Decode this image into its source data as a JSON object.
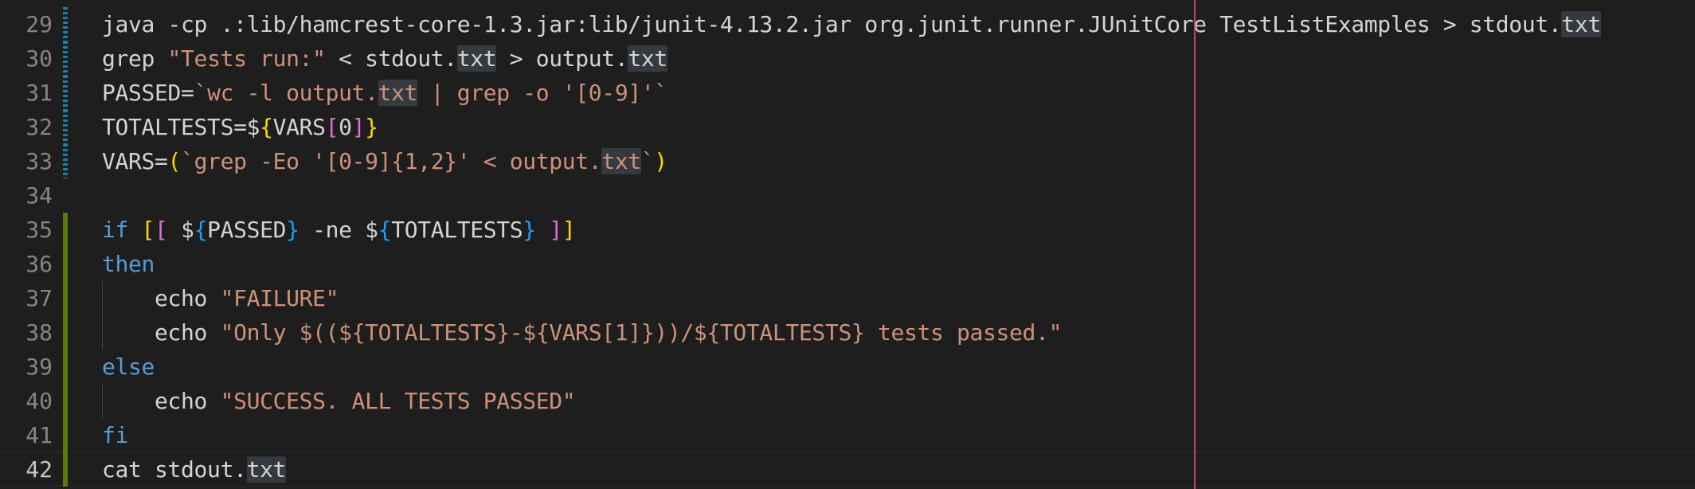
{
  "editor": {
    "lines": [
      {
        "number": "29",
        "gutter": "modified",
        "current": false,
        "tokens": [
          {
            "t": "java -cp .:lib/hamcrest-core-1.3.jar:lib/junit-4.13.2.jar org.junit.runner.JUnitCore TestListExamples > stdout.",
            "c": ""
          },
          {
            "t": "txt",
            "c": "hl"
          }
        ]
      },
      {
        "number": "30",
        "gutter": "modified",
        "current": false,
        "tokens": [
          {
            "t": "grep ",
            "c": ""
          },
          {
            "t": "\"Tests run:\"",
            "c": "str"
          },
          {
            "t": " < stdout.",
            "c": ""
          },
          {
            "t": "txt",
            "c": "hl"
          },
          {
            "t": " > output.",
            "c": ""
          },
          {
            "t": "txt",
            "c": "hl"
          }
        ]
      },
      {
        "number": "31",
        "gutter": "modified",
        "current": false,
        "tokens": [
          {
            "t": "PASSED=",
            "c": ""
          },
          {
            "t": "`wc -l output.",
            "c": "str"
          },
          {
            "t": "txt",
            "c": "str hl"
          },
          {
            "t": " | grep -o '[0-9]'`",
            "c": "str"
          }
        ]
      },
      {
        "number": "32",
        "gutter": "modified",
        "current": false,
        "tokens": [
          {
            "t": "TOTALTESTS=$",
            "c": ""
          },
          {
            "t": "{",
            "c": "b1"
          },
          {
            "t": "VARS",
            "c": ""
          },
          {
            "t": "[",
            "c": "b2"
          },
          {
            "t": "0",
            "c": ""
          },
          {
            "t": "]",
            "c": "b2"
          },
          {
            "t": "}",
            "c": "b1"
          }
        ]
      },
      {
        "number": "33",
        "gutter": "modified",
        "current": false,
        "tokens": [
          {
            "t": "VARS=",
            "c": ""
          },
          {
            "t": "(",
            "c": "b1"
          },
          {
            "t": "`grep -Eo '[0-9]{1,2}' < output.",
            "c": "str"
          },
          {
            "t": "txt",
            "c": "str hl"
          },
          {
            "t": "`",
            "c": "str"
          },
          {
            "t": ")",
            "c": "b1"
          }
        ]
      },
      {
        "number": "34",
        "gutter": "none",
        "current": false,
        "tokens": []
      },
      {
        "number": "35",
        "gutter": "added",
        "current": false,
        "tokens": [
          {
            "t": "if ",
            "c": "kw"
          },
          {
            "t": "[",
            "c": "b1"
          },
          {
            "t": "[",
            "c": "b2"
          },
          {
            "t": " $",
            "c": ""
          },
          {
            "t": "{",
            "c": "b3"
          },
          {
            "t": "PASSED",
            "c": ""
          },
          {
            "t": "}",
            "c": "b3"
          },
          {
            "t": " -ne $",
            "c": ""
          },
          {
            "t": "{",
            "c": "b3"
          },
          {
            "t": "TOTALTESTS",
            "c": ""
          },
          {
            "t": "}",
            "c": "b3"
          },
          {
            "t": " ",
            "c": ""
          },
          {
            "t": "]",
            "c": "b2"
          },
          {
            "t": "]",
            "c": "b1"
          }
        ]
      },
      {
        "number": "36",
        "gutter": "added",
        "current": false,
        "tokens": [
          {
            "t": "then",
            "c": "kw"
          }
        ]
      },
      {
        "number": "37",
        "gutter": "added",
        "current": false,
        "indent": true,
        "tokens": [
          {
            "t": "    echo ",
            "c": ""
          },
          {
            "t": "\"FAILURE\"",
            "c": "str"
          }
        ]
      },
      {
        "number": "38",
        "gutter": "added",
        "current": false,
        "indent": true,
        "tokens": [
          {
            "t": "    echo ",
            "c": ""
          },
          {
            "t": "\"Only $(($",
            "c": "str"
          },
          {
            "t": "{TOTALTESTS}",
            "c": "str"
          },
          {
            "t": "-$",
            "c": "str"
          },
          {
            "t": "{VARS[1]}",
            "c": "str"
          },
          {
            "t": "))/$",
            "c": "str"
          },
          {
            "t": "{TOTALTESTS}",
            "c": "str"
          },
          {
            "t": " tests passed.\"",
            "c": "str"
          }
        ]
      },
      {
        "number": "39",
        "gutter": "added",
        "current": false,
        "tokens": [
          {
            "t": "else",
            "c": "kw"
          }
        ]
      },
      {
        "number": "40",
        "gutter": "added",
        "current": false,
        "indent": true,
        "tokens": [
          {
            "t": "    echo ",
            "c": ""
          },
          {
            "t": "\"SUCCESS. ALL TESTS PASSED\"",
            "c": "str"
          }
        ]
      },
      {
        "number": "41",
        "gutter": "added",
        "current": false,
        "tokens": [
          {
            "t": "fi",
            "c": "kw"
          }
        ]
      },
      {
        "number": "42",
        "gutter": "added",
        "current": true,
        "tokens": [
          {
            "t": "cat stdout.",
            "c": ""
          },
          {
            "t": "txt",
            "c": "hl"
          }
        ]
      }
    ]
  },
  "colors": {
    "background": "#1e1e1e",
    "keyword": "#569cd6",
    "string": "#ce9178",
    "ruler": "#b8476f",
    "added_gutter": "#587c0c",
    "modified_gutter": "#1b81a8"
  }
}
